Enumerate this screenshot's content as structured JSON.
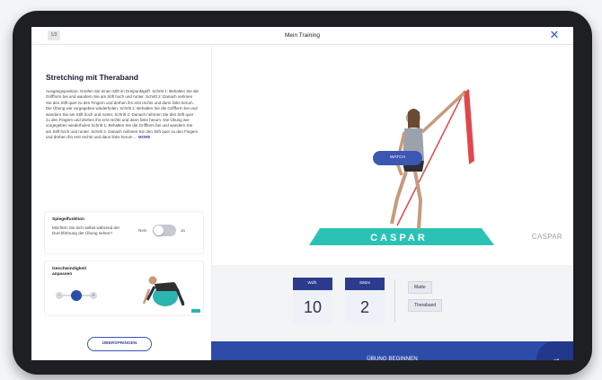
{
  "header": {
    "counter": "1/3",
    "title": "Mein Training",
    "close_symbol": "✕"
  },
  "exercise": {
    "title": "Stretching mit Theraband",
    "description": "Ausgangsposition: Greifen Sie einen Stift im Dreipunktgriff. Schritt 1: Behalten Sie die Griffform bei und wandern Sie am Stift hoch und runter. Schritt 2: Danach nehmen Sie den Stift quer zu den Fingern und drehen ihn erst rechts und dann links herum. Die Übung wie vorgegeben wiederholen. Schritt 1: Behalten Sie die Griffform bei und wandern Sie am Stift hoch und runter. Schritt 2: Danach nehmen Sie den Stift quer zu den Fingern und drehen ihn erst rechts und dann links herum. Die Übung wie vorgegeben wiederholen Schritt 1: Behalten Sie die Griffform bei und wandern Sie am Stift hoch und runter. Schritt 2: Danach nehmen Sie den Stift quer zu den Fingern und drehen ihn erst rechts und dann links herum ...",
    "more_label": "MORE"
  },
  "mirror": {
    "label": "Spiegelfunktion",
    "question": "Möchten Sie sich selbst während der Durchführung der Übung sehen?",
    "off_label": "Nein",
    "on_label": "Ja",
    "enabled": false
  },
  "speed": {
    "label": "Geschwindigkeit anpassen",
    "minus": "−",
    "plus": "+",
    "level": 0.5
  },
  "skip_label": "ÜBERSPRINGEN",
  "video": {
    "watch_label": "WATCH",
    "mat_text": "CASPAR",
    "brand": "CASPAR"
  },
  "counters": [
    {
      "label": "Wdh.",
      "value": "10"
    },
    {
      "label": "Sätze",
      "value": "2"
    }
  ],
  "equipment": [
    "Matte",
    "Theraband"
  ],
  "start_label": "ÜBUNG BEGINNEN",
  "start_arrow": "→",
  "colors": {
    "primary": "#2d4ba8",
    "dark_primary": "#22388a",
    "accent_teal": "#2bb5b0",
    "band_red": "#e0474c"
  }
}
